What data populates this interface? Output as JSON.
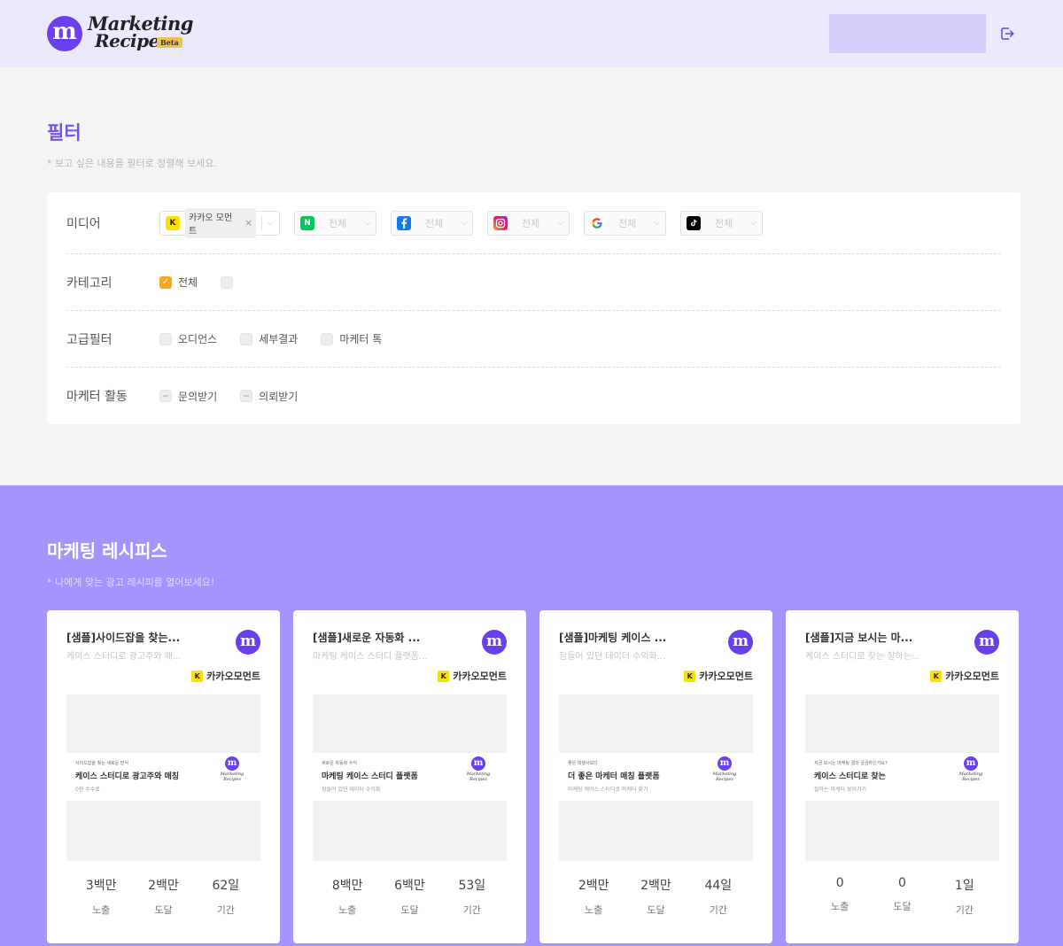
{
  "header": {
    "logo_letter": "m",
    "logo_line1": "Marketing",
    "logo_line2": "Recipes",
    "logo_badge": "Beta"
  },
  "filter": {
    "title": "필터",
    "subtitle": "* 보고 싶은 내용을 필터로 정렬해 보세요.",
    "media_label": "미디어",
    "kakao_tag": "카카오 모먼트",
    "kakao_icon": "K",
    "naver_icon": "N",
    "all_label": "전체",
    "category_label": "카테고리",
    "category_all": "전체",
    "advanced_label": "고급필터",
    "advanced_options": [
      "오디언스",
      "세부결과",
      "마케터 톡"
    ],
    "activity_label": "마케터 활동",
    "activity_options": [
      "문의받기",
      "의뢰받기"
    ],
    "colors": {
      "accent": "#7a4ff2",
      "checked": "#f5a623"
    }
  },
  "recipes": {
    "title": "마케팅 레시피스",
    "subtitle": "* 나에게 맞는 광고 레시피를 열어보세요!",
    "stat_labels": [
      "노출",
      "도달",
      "기간"
    ],
    "cards": [
      {
        "title": "[샘플]사이드잡을 찾는...",
        "desc": "케이스 스터디로 광고주와 매...",
        "media": "카카오모먼트",
        "thumb_small": "사이드잡을 찾는 새로운 방식",
        "thumb_main": "케이스 스터디로 광고주와 매칭",
        "thumb_sub": "0원 수수료",
        "stats": [
          "3백만",
          "2백만",
          "62일"
        ]
      },
      {
        "title": "[샘플]새로운 자동화 ...",
        "desc": "마케팅 케이스 스터디 플랫폼...",
        "media": "카카오모먼트",
        "thumb_small": "새로운 자동화 수익",
        "thumb_main": "마케팅 케이스 스터디 플랫폼",
        "thumb_sub": "잠들어 있던 데이터 수익화",
        "stats": [
          "8백만",
          "6백만",
          "53일"
        ]
      },
      {
        "title": "[샘플]마케팅 케이스 ...",
        "desc": "잠들어 있던 데이터 수익화...",
        "media": "카카오모먼트",
        "thumb_small": "좋은 대행사보다",
        "thumb_main": "더 좋은 마케터 매칭 플랫폼",
        "thumb_sub": "마케팅 케이스 스터디로 마케터 찾기",
        "stats": [
          "2백만",
          "2백만",
          "44일"
        ]
      },
      {
        "title": "[샘플]지금 보시는 마...",
        "desc": "케이스 스터디로 찾는 잘하는...",
        "media": "카카오모먼트",
        "thumb_small": "지금 보시는 마케팅 결과 궁금하신가요?",
        "thumb_main": "케이스 스터디로 찾는",
        "thumb_sub": "잘하는 마케터 보러가기",
        "stats": [
          "0",
          "0",
          "1일"
        ]
      }
    ]
  }
}
